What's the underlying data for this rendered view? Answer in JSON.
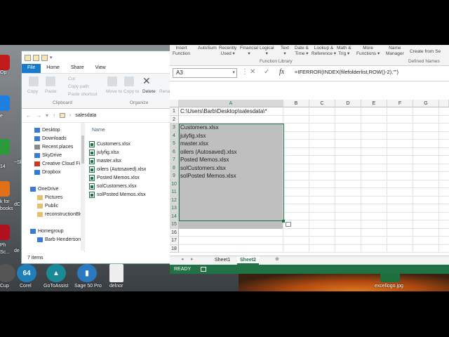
{
  "desktop": {
    "left_edge_labels": [
      "Op",
      "",
      "e",
      "",
      "14",
      "",
      "k for",
      "books",
      "",
      "Ph",
      "Sc..."
    ],
    "icons": [
      {
        "label": "Cup",
        "color": "#444"
      },
      {
        "label": "Corel",
        "color": "#1f7fb8",
        "glyph": "64"
      },
      {
        "label": "GoToAssist",
        "color": "#1a8a99",
        "glyph": "▲"
      },
      {
        "label": "Sage 50 Pro",
        "color": "#2a7ac0",
        "glyph": "▮"
      },
      {
        "label": "delnor",
        "color": "#eeeeee",
        "glyph": ""
      }
    ],
    "right_icon_label": "excellogo.jpg",
    "mid_labels": [
      "~Sl",
      "dC",
      "de"
    ]
  },
  "explorer": {
    "tabs": [
      "File",
      "Home",
      "Share",
      "View"
    ],
    "ribbon": {
      "buttons": [
        "Copy",
        "Paste",
        "Cut",
        "Copy path",
        "Paste shortcut",
        "Move to",
        "Copy to",
        "Delete",
        "Rena"
      ],
      "groups": [
        "Clipboard",
        "Organize"
      ]
    },
    "breadcrumb": "salesdata",
    "nav_items": [
      {
        "label": "Desktop",
        "color": "#3a7bd5"
      },
      {
        "label": "Downloads",
        "color": "#3a7bd5"
      },
      {
        "label": "Recent places",
        "color": "#8a8a8a"
      },
      {
        "label": "SkyDrive",
        "color": "#3a7bd5"
      },
      {
        "label": "Creative Cloud Fi",
        "color": "#d0351f"
      },
      {
        "label": "Dropbox",
        "color": "#2a7ae2"
      },
      {
        "label": "",
        "color": "transparent"
      },
      {
        "label": "OneDrive",
        "color": "#3a7bd5"
      },
      {
        "label": "Pictures",
        "color": "#e3c06a"
      },
      {
        "label": "Public",
        "color": "#e3c06a"
      },
      {
        "label": "reconstructionBH",
        "color": "#e3c06a"
      },
      {
        "label": "",
        "color": "transparent"
      },
      {
        "label": "Homegroup",
        "color": "#3a7bd5"
      },
      {
        "label": "Barb Henderson",
        "color": "#3a7bd5"
      }
    ],
    "column_header": "Name",
    "files": [
      "Customers.xlsx",
      "julyfig.xlsx",
      "master.xlsx",
      "oilers (Autosaved).xlsx",
      "Posted Memos.xlsx",
      "solCustomers.xlsx",
      "solPosted Memos.xlsx"
    ],
    "status": "7 items"
  },
  "excel": {
    "ribbon_items": [
      {
        "top": "Insert",
        "bottom": "Function"
      },
      {
        "top": "AutoSum",
        "bottom": ""
      },
      {
        "top": "Recently",
        "bottom": "Used ▾"
      },
      {
        "top": "Financial",
        "bottom": "▾"
      },
      {
        "top": "Logical",
        "bottom": "▾"
      },
      {
        "top": "Text",
        "bottom": "▾"
      },
      {
        "top": "Date &",
        "bottom": "Time ▾"
      },
      {
        "top": "Lookup &",
        "bottom": "Reference ▾"
      },
      {
        "top": "Math &",
        "bottom": "Trig ▾"
      },
      {
        "top": "More",
        "bottom": "Functions ▾"
      },
      {
        "top": "Name",
        "bottom": "Manager"
      }
    ],
    "ribbon_right": "Create from Se",
    "ribbon_groups": [
      "Function Library",
      "Defined Names"
    ],
    "name_box": "A3",
    "formula": "=IFERROR(INDEX(filefolderlist,ROW()-2),\"\")",
    "columns": [
      "A",
      "B",
      "C",
      "D",
      "E",
      "F",
      "G"
    ],
    "rows": [
      {
        "n": "1",
        "a": "C:\\Users\\Barb\\Desktop\\salesdata\\*"
      },
      {
        "n": "2",
        "a": ""
      },
      {
        "n": "3",
        "a": "Customers.xlsx"
      },
      {
        "n": "4",
        "a": "julyfig.xlsx"
      },
      {
        "n": "5",
        "a": "master.xlsx"
      },
      {
        "n": "6",
        "a": "oilers (Autosaved).xlsx"
      },
      {
        "n": "7",
        "a": "Posted Memos.xlsx"
      },
      {
        "n": "8",
        "a": "solCustomers.xlsx"
      },
      {
        "n": "9",
        "a": "solPosted Memos.xlsx"
      },
      {
        "n": "10",
        "a": ""
      },
      {
        "n": "11",
        "a": ""
      },
      {
        "n": "12",
        "a": ""
      },
      {
        "n": "13",
        "a": ""
      },
      {
        "n": "14",
        "a": ""
      },
      {
        "n": "15",
        "a": ""
      },
      {
        "n": "16",
        "a": ""
      },
      {
        "n": "17",
        "a": ""
      },
      {
        "n": "18",
        "a": ""
      }
    ],
    "selected_rows": [
      "3",
      "15"
    ],
    "sheets": [
      "Sheet1",
      "Sheet2"
    ],
    "active_sheet": "Sheet2",
    "status": "READY",
    "accent": "#217346"
  }
}
